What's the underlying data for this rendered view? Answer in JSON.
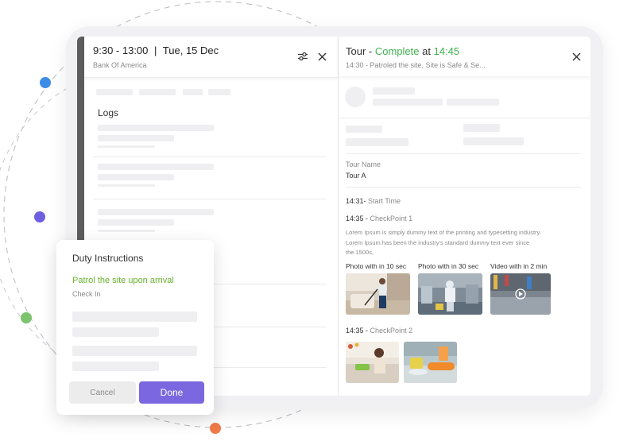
{
  "colors": {
    "accent_purple": "#7b68e0",
    "status_green": "#3fb24f",
    "action_green": "#67b32d",
    "dot_blue": "#3d8de8",
    "dot_purple": "#6f5fe0",
    "dot_green": "#7cc46e",
    "dot_orange": "#f07a4a"
  },
  "left": {
    "time_range": "9:30 - 13:00",
    "separator": "|",
    "date": "Tue, 15 Dec",
    "site": "Bank Of America",
    "logs_title": "Logs",
    "filter_icon": "sliders-icon",
    "close_icon": "close-icon"
  },
  "right": {
    "title_prefix": "Tour -",
    "status": "Complete",
    "at_word": "at",
    "complete_time": "14:45",
    "subtitle": "14:30 - Patroled the site, Site is Safe & Se...",
    "tour_name_label": "Tour Name",
    "tour_name_value": "Tour A",
    "start_time": "14:31-",
    "start_label": "Start Time",
    "checkpoint1_time": "14:35 -",
    "checkpoint1_label": "CheckPoint 1",
    "lorem_line1": "Lorem Ipsum is simply dummy text of the printing and typesetting industry.",
    "lorem_line2": "Lorem Ipsum has been the industry's standard dummy text ever since",
    "lorem_line3": "the 1500s,",
    "media_labels": [
      "Photo with in 10 sec",
      "Photo with in 30 sec",
      "Video with in 2 min"
    ],
    "checkpoint2_time": "14:35 -",
    "checkpoint2_label": "CheckPoint 2"
  },
  "duty_card": {
    "title": "Duty Instructions",
    "action": "Patrol the site upon arrival",
    "sub": "Check In",
    "cancel_label": "Cancel",
    "done_label": "Done"
  }
}
